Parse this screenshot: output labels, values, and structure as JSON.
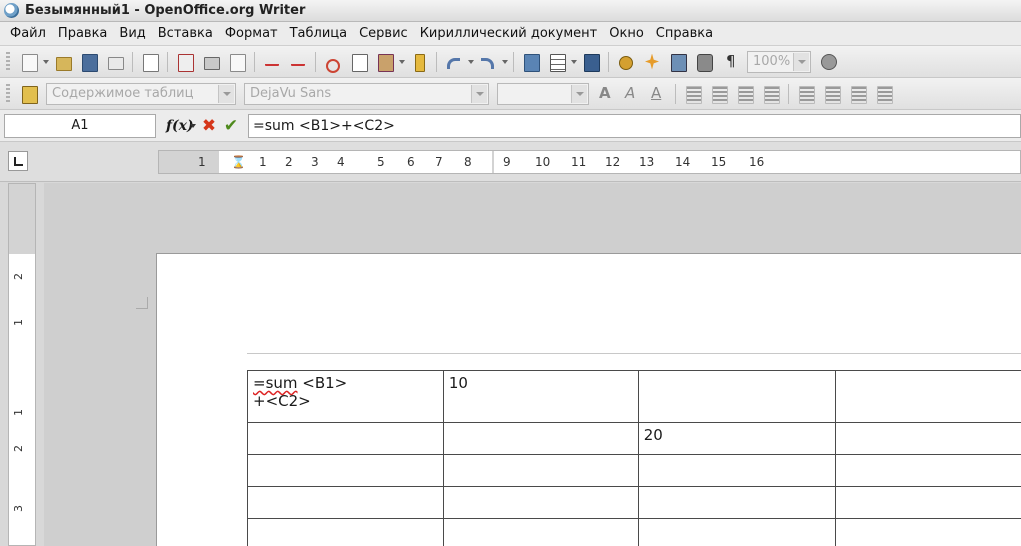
{
  "window": {
    "title": "Безымянный1 - OpenOffice.org Writer"
  },
  "menu": [
    "Файл",
    "Правка",
    "Вид",
    "Вставка",
    "Формат",
    "Таблица",
    "Сервис",
    "Кириллический документ",
    "Окно",
    "Справка"
  ],
  "standard_toolbar": {
    "zoom": "100%"
  },
  "formatting_toolbar": {
    "paragraph_style": "Содержимое таблиц",
    "font_name": "DejaVu Sans",
    "font_size": ""
  },
  "formula_bar": {
    "cell_ref": "A1",
    "formula": "=sum <B1>+<C2>"
  },
  "ruler": {
    "horizontal_ticks": [
      "1",
      "1",
      "2",
      "3",
      "4",
      "5",
      "6",
      "7",
      "8",
      "9",
      "10",
      "11",
      "12",
      "13",
      "14",
      "15",
      "16"
    ],
    "vertical_ticks": [
      "2",
      "1",
      "1",
      "2",
      "3"
    ]
  },
  "table": {
    "rows": [
      [
        "=sum <B1>\n+<C2>",
        "10",
        "",
        ""
      ],
      [
        "",
        "",
        "20",
        ""
      ],
      [
        "",
        "",
        "",
        ""
      ],
      [
        "",
        "",
        "",
        ""
      ],
      [
        "",
        "",
        "",
        ""
      ]
    ]
  },
  "icons": {
    "app": "openoffice-icon",
    "fx": "function-icon",
    "cancel": "cancel-x-icon",
    "accept": "accept-check-icon"
  },
  "colors": {
    "cancel": "#d5361a",
    "accept": "#4e8a1c",
    "spellcheck": "#d22222"
  }
}
